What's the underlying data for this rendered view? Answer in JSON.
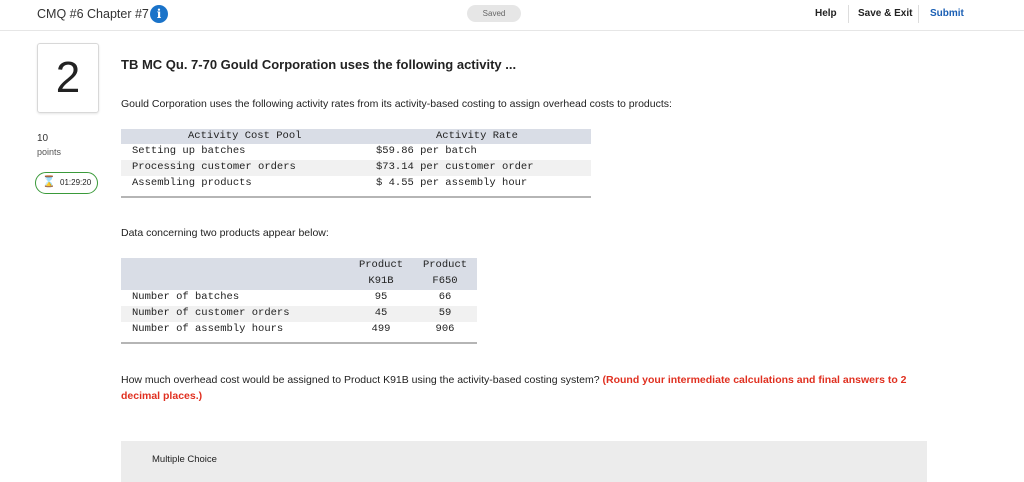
{
  "header": {
    "title": "CMQ #6 Chapter #7",
    "info_icon": "i",
    "saved": "Saved",
    "help": "Help",
    "save_exit": "Save & Exit",
    "submit": "Submit"
  },
  "sidebar": {
    "question_number": "2",
    "points_value": "10",
    "points_label": "points",
    "timer": "01:29:20"
  },
  "question": {
    "title": "TB MC Qu. 7-70 Gould Corporation uses the following activity ...",
    "intro": "Gould Corporation uses the following activity rates from its activity-based costing to assign overhead costs to products:",
    "rates_table": {
      "headers": [
        "Activity Cost Pool",
        "Activity Rate"
      ],
      "rows": [
        [
          "Setting up batches",
          "$59.86 per batch"
        ],
        [
          "Processing customer orders",
          "$73.14 per customer order"
        ],
        [
          "Assembling products",
          "$ 4.55 per assembly hour"
        ]
      ]
    },
    "data_intro": "Data concerning two products appear below:",
    "products_table": {
      "headers": [
        [
          "Product",
          "K91B"
        ],
        [
          "Product",
          "F650"
        ]
      ],
      "rows": [
        [
          "Number of batches",
          "95",
          "66"
        ],
        [
          "Number of customer orders",
          "45",
          "59"
        ],
        [
          "Number of assembly hours",
          "499",
          "906"
        ]
      ]
    },
    "prompt": "How much overhead cost would be assigned to Product K91B using the activity-based costing system?",
    "instruction": "(Round your intermediate calculations and final answers to 2 decimal places.)",
    "answer_type": "Multiple Choice"
  }
}
